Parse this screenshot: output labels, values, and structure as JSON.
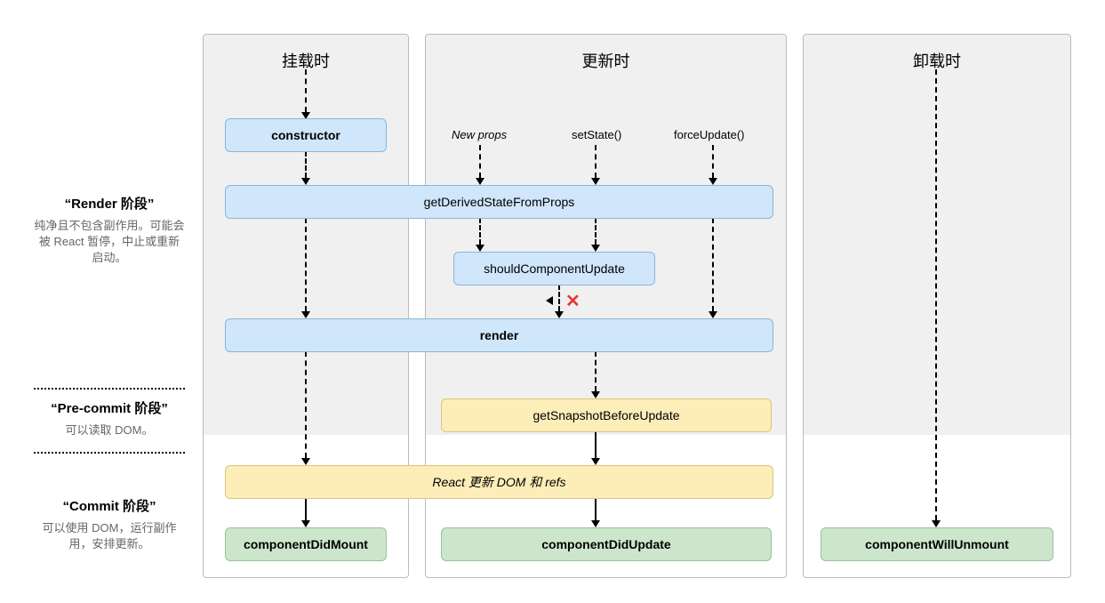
{
  "columns": {
    "mount": "挂载时",
    "update": "更新时",
    "unmount": "卸载时"
  },
  "phases": {
    "render": {
      "title": "“Render 阶段”",
      "desc": "纯净且不包含副作用。可能会被 React 暂停，中止或重新启动。"
    },
    "precommit": {
      "title": "“Pre-commit 阶段”",
      "desc": "可以读取 DOM。"
    },
    "commit": {
      "title": "“Commit 阶段”",
      "desc": "可以使用 DOM，运行副作用，安排更新。"
    }
  },
  "triggers": {
    "newprops": "New props",
    "setState": "setState()",
    "forceUpdate": "forceUpdate()"
  },
  "lifecycles": {
    "constructor": "constructor",
    "gdsfp": "getDerivedStateFromProps",
    "scu": "shouldComponentUpdate",
    "render": "render",
    "gsbu": "getSnapshotBeforeUpdate",
    "updateDomRefs": "React 更新 DOM 和 refs",
    "cdm": "componentDidMount",
    "cdu": "componentDidUpdate",
    "cwu": "componentWillUnmount"
  },
  "symbols": {
    "x": "✕"
  }
}
